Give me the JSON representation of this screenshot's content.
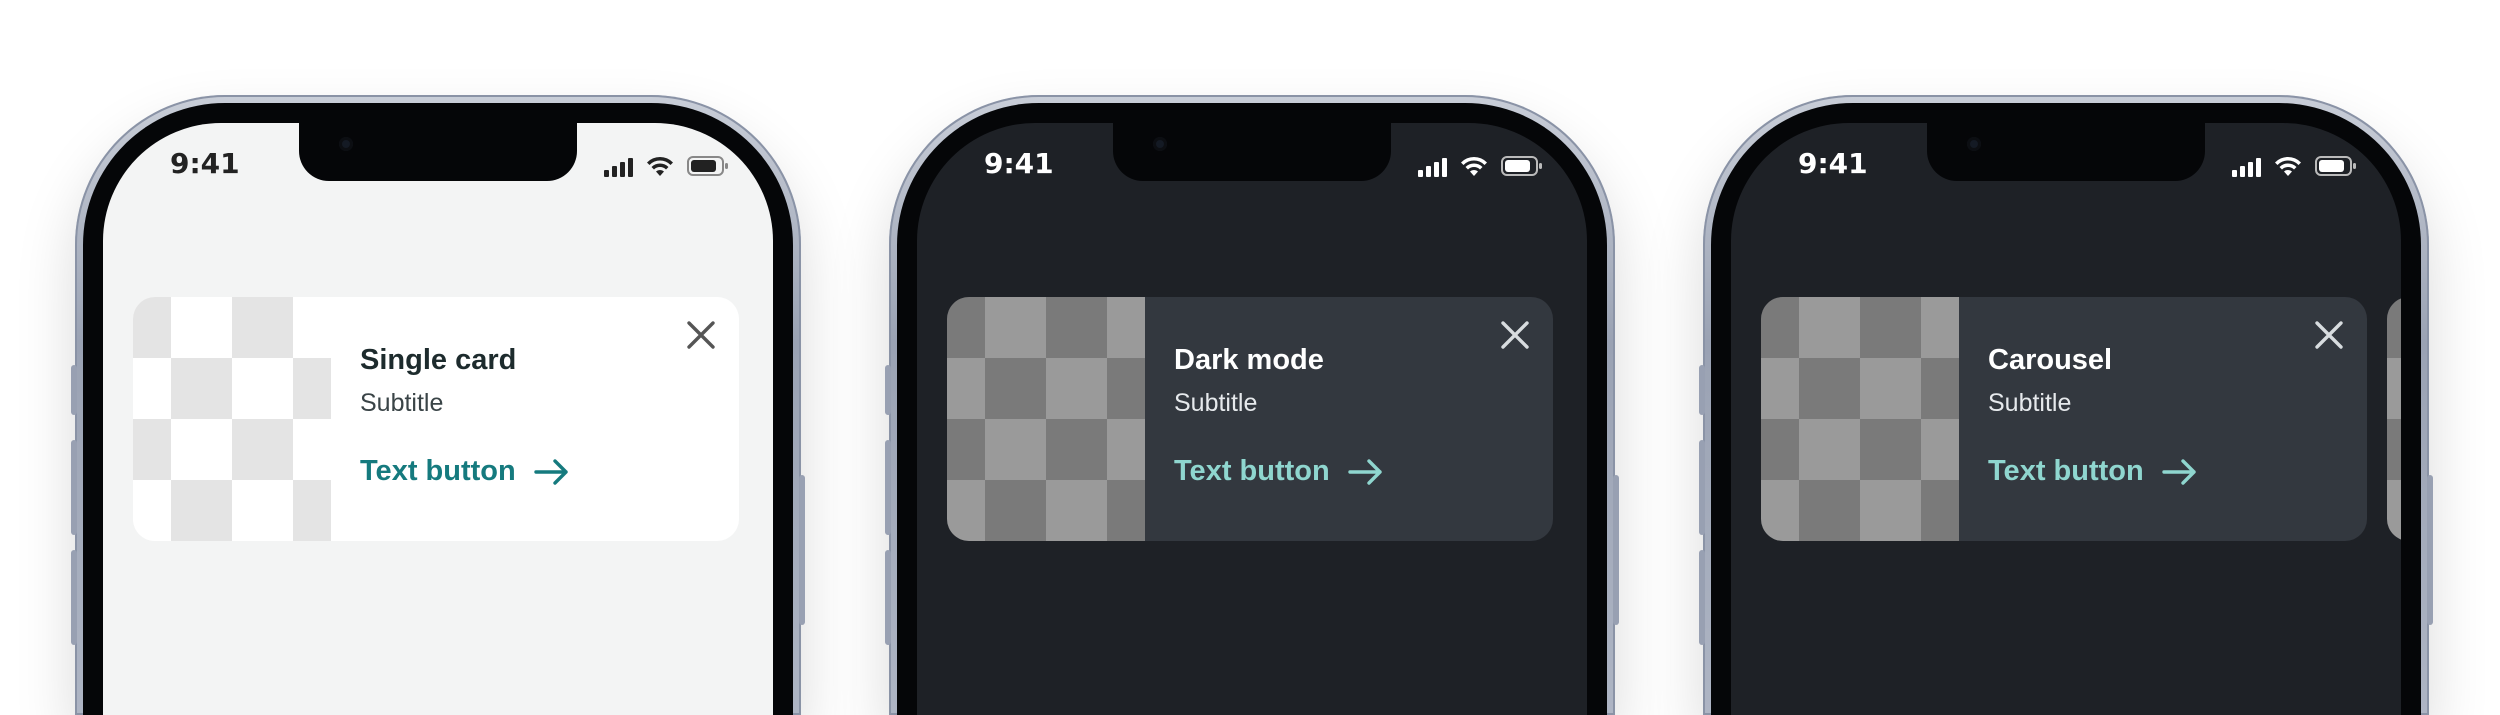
{
  "colors": {
    "light_bg": "#f3f4f4",
    "dark_bg": "#1e2126",
    "light_card": "#ffffff",
    "dark_card": "#33383f",
    "light_accent": "#157a7e",
    "dark_accent": "#8fd6cf"
  },
  "phones": [
    {
      "theme": "light",
      "status": {
        "time": "9:41"
      },
      "card": {
        "title": "Single card",
        "subtitle": "Subtitle",
        "action_label": "Text button",
        "close_icon": "close-icon",
        "action_icon": "arrow-right-icon"
      }
    },
    {
      "theme": "dark",
      "status": {
        "time": "9:41"
      },
      "card": {
        "title": "Dark mode",
        "subtitle": "Subtitle",
        "action_label": "Text button",
        "close_icon": "close-icon",
        "action_icon": "arrow-right-icon"
      }
    },
    {
      "theme": "dark",
      "status": {
        "time": "9:41"
      },
      "card": {
        "title": "Carousel",
        "subtitle": "Subtitle",
        "action_label": "Text button",
        "close_icon": "close-icon",
        "action_icon": "arrow-right-icon"
      },
      "has_next_card_peek": true
    }
  ]
}
